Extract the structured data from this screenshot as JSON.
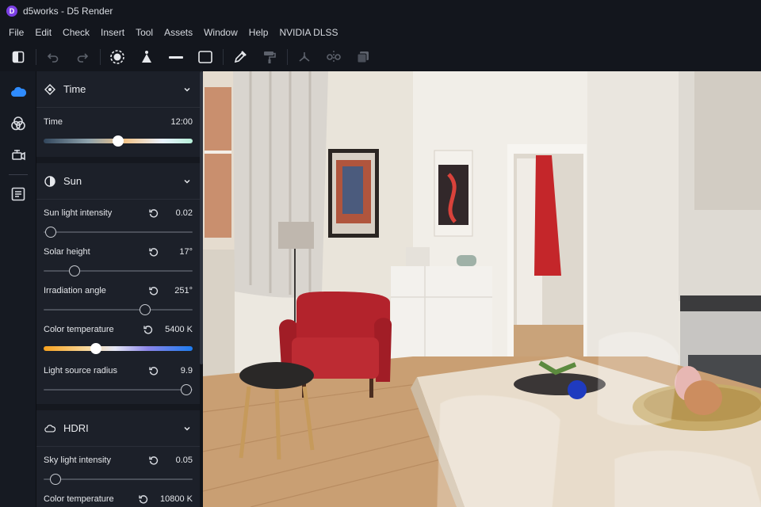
{
  "window": {
    "title": "d5works - D5 Render",
    "logo_letter": "D"
  },
  "menu": [
    "File",
    "Edit",
    "Check",
    "Insert",
    "Tool",
    "Assets",
    "Window",
    "Help",
    "NVIDIA DLSS"
  ],
  "toolbar": {
    "icons": [
      "panel-toggle-icon",
      "undo-icon",
      "redo-icon",
      "select-icon",
      "cone-light-icon",
      "strip-light-icon",
      "rect-light-icon",
      "eyedropper-icon",
      "paint-roller-icon",
      "transform-icon",
      "mirror-icon",
      "stack-icon"
    ]
  },
  "rail": {
    "icons": [
      "weather-icon",
      "effects-icon",
      "camera-icon",
      "list-icon"
    ]
  },
  "colors": {
    "accent": "#2f8cff",
    "panel": "#1c2029",
    "toolbar": "#13161d"
  },
  "sections": {
    "time": {
      "title": "Time",
      "label": "Time",
      "value": "12:00",
      "level": 0.5
    },
    "sun": {
      "title": "Sun",
      "rows": [
        {
          "label": "Sun light intensity",
          "value": "0.02",
          "level": 0.05
        },
        {
          "label": "Solar height",
          "value": "17°",
          "level": 0.21
        },
        {
          "label": "Irradiation angle",
          "value": "251°",
          "level": 0.68
        },
        {
          "label": "Color temperature",
          "value": "5400 K",
          "level": 0.35
        },
        {
          "label": "Light source radius",
          "value": "9.9",
          "level": 0.96
        }
      ]
    },
    "hdri": {
      "title": "HDRI",
      "rows": [
        {
          "label": "Sky light intensity",
          "value": "0.05",
          "level": 0.08
        },
        {
          "label": "Color temperature",
          "value": "10800 K"
        }
      ]
    }
  }
}
